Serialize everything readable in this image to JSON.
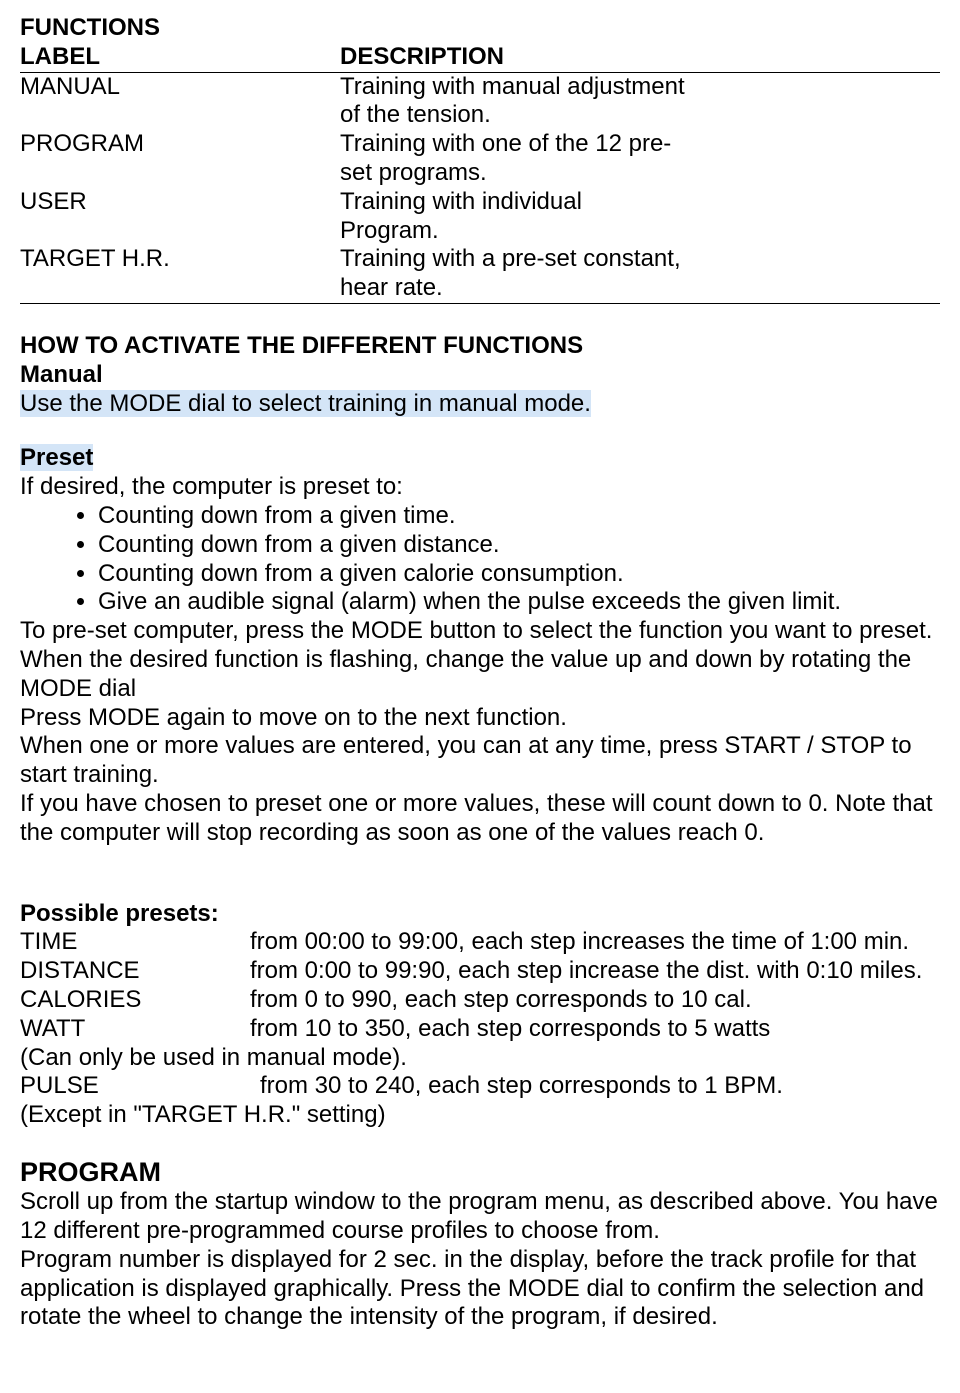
{
  "functions": {
    "title": "FUNCTIONS",
    "header_label": "LABEL",
    "header_description": "DESCRIPTION",
    "rows": [
      {
        "label": "MANUAL",
        "desc1": "Training with manual adjustment",
        "desc2": "of the tension."
      },
      {
        "label": "PROGRAM",
        "desc1": "Training with one of the 12 pre-",
        "desc2": "set programs."
      },
      {
        "label": "USER",
        "desc1": "Training with individual",
        "desc2": "Program."
      },
      {
        "label": "TARGET H.R.",
        "desc1": "Training with a pre-set constant,",
        "desc2": "hear rate."
      }
    ]
  },
  "activate": {
    "title": "HOW TO ACTIVATE THE DIFFERENT FUNCTIONS",
    "manual_label": "Manual",
    "manual_text": "Use the MODE dial to select training in manual mode.",
    "preset_label": "Preset",
    "preset_intro": "If desired, the computer is preset to:",
    "bullets": [
      "Counting down from a given time.",
      "Counting down from a given distance.",
      "Counting down from a given calorie consumption.",
      "Give an audible signal (alarm) when the pulse exceeds the given limit."
    ],
    "para1": "To pre-set computer, press the MODE button to select the function you want to preset. When the desired function is flashing, change the value up and down by rotating the MODE dial",
    "para2": "Press MODE again to move on to the next function.",
    "para3": "When one or more values are entered, you can at any time, press START / STOP to start training.",
    "para4": "If you have chosen to preset one or more values, these will count down to 0. Note that the computer will stop recording as soon as one of the values reach 0."
  },
  "presets": {
    "title": "Possible presets:",
    "rows": [
      {
        "label": "TIME",
        "desc": "from 00:00 to 99:00, each step increases the time of 1:00 min."
      },
      {
        "label": "DISTANCE",
        "desc": "from 0:00 to 99:90, each step increase the dist. with 0:10 miles."
      },
      {
        "label": "CALORIES",
        "desc": "from 0 to 990, each step corresponds to 10 cal."
      },
      {
        "label": "WATT",
        "desc": "from 10 to 350, each step corresponds to 5 watts"
      }
    ],
    "watt_note": "(Can only be used in manual mode).",
    "pulse_label": "PULSE",
    "pulse_desc": "from 30 to 240, each step corresponds to 1 BPM.",
    "pulse_note": "(Except in \"TARGET H.R.\" setting)"
  },
  "program": {
    "title": "PROGRAM",
    "para1": "Scroll up from the startup window to the program menu, as described above. You have 12 different pre-programmed course profiles to choose from.",
    "para2": "Program number is displayed for 2 sec. in the display, before the track profile for that application is displayed graphically. Press the MODE dial to confirm the selection and rotate the wheel to change the intensity of the program, if desired."
  }
}
